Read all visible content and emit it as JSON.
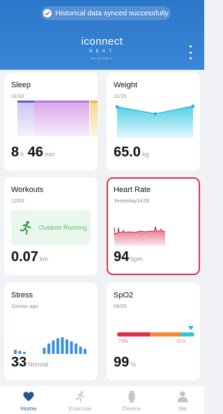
{
  "status": {
    "toast": "Historical data synced successfully"
  },
  "brand": {
    "line1": "iconnect",
    "line2": "NEXT",
    "line3": "BY ETIMEX"
  },
  "cards": {
    "sleep": {
      "title": "Sleep",
      "date": "11/10",
      "hours": "8",
      "hours_unit": "h",
      "minutes": "46",
      "minutes_unit": "min"
    },
    "weight": {
      "title": "Weight",
      "date": "11/15",
      "value": "65.0",
      "unit": "kg"
    },
    "workouts": {
      "title": "Workouts",
      "date": "12/03",
      "activity": "Outdoor Running",
      "value": "0.07",
      "unit": "km"
    },
    "heart_rate": {
      "title": "Heart Rate",
      "date": "Yesterday14:05",
      "value": "94",
      "unit": "bpm"
    },
    "stress": {
      "title": "Stress",
      "date": "10mins ago",
      "value": "33",
      "label": "Normal",
      "bars": [
        0.2,
        0.15,
        0.1,
        0.3,
        0.5,
        0.65,
        0.75,
        0.8,
        0.7,
        0.6,
        0.5,
        0.35,
        0.25
      ]
    },
    "spo2": {
      "title": "SpO2",
      "date": "09/25",
      "value": "99",
      "unit": "%",
      "range_low": "73%",
      "range_high": "90%"
    }
  },
  "nav": {
    "items": [
      {
        "label": "Home",
        "icon": "heart-icon",
        "active": true
      },
      {
        "label": "Exercise",
        "icon": "runner-icon",
        "active": false
      },
      {
        "label": "Device",
        "icon": "watch-icon",
        "active": false
      },
      {
        "label": "Me",
        "icon": "person-icon",
        "active": false
      }
    ]
  },
  "colors": {
    "header": "#2b76c8",
    "heart_border": "#d8334a",
    "nav_active": "#2a5e9c",
    "workout_green": "#5bbf72",
    "stress_blue": "#3a8fe0"
  }
}
